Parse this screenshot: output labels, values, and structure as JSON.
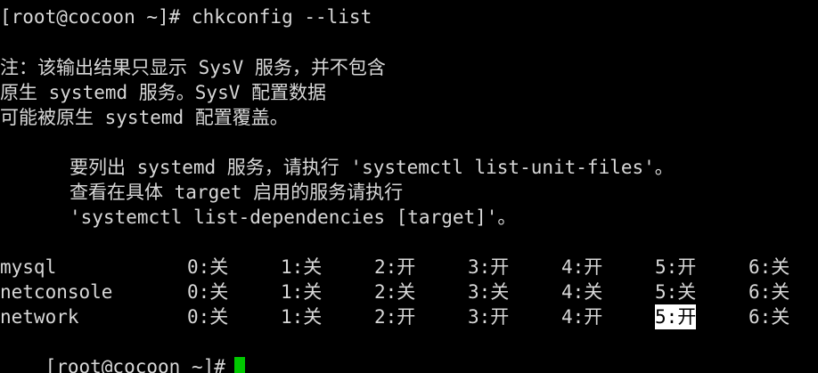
{
  "terminal": {
    "prompt1": "[root@cocoon ~]# chkconfig --list",
    "note_line1": "注：该输出结果只显示 SysV 服务，并不包含",
    "note_line2": "原生 systemd 服务。SysV 配置数据",
    "note_line3": "可能被原生 systemd 配置覆盖。",
    "hint_line1": "要列出 systemd 服务，请执行 'systemctl list-unit-files'。",
    "hint_line2": "查看在具体 target 启用的服务请执行",
    "hint_line3": "'systemctl list-dependencies [target]'。",
    "services": [
      {
        "name": "mysql",
        "levels": [
          "0:关",
          "1:关",
          "2:开",
          "3:开",
          "4:开",
          "5:开",
          "6:关"
        ]
      },
      {
        "name": "netconsole",
        "levels": [
          "0:关",
          "1:关",
          "2:关",
          "3:关",
          "4:关",
          "5:关",
          "6:关"
        ]
      },
      {
        "name": "network",
        "levels": [
          "0:关",
          "1:关",
          "2:开",
          "3:开",
          "4:开",
          "5:开",
          "6:关"
        ]
      }
    ],
    "prompt2": "[root@cocoon ~]#",
    "cursor_color": "#00c800"
  }
}
